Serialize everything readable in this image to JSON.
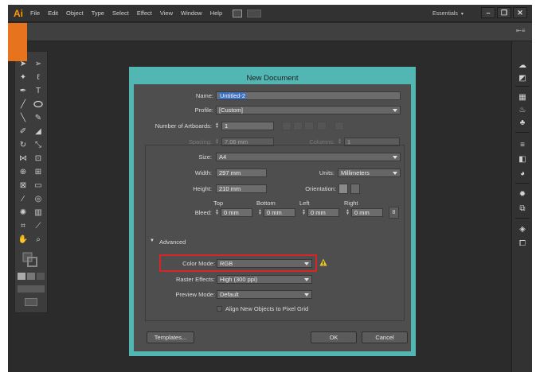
{
  "app": {
    "logo": "Ai",
    "menu": [
      "File",
      "Edit",
      "Object",
      "Type",
      "Select",
      "Effect",
      "View",
      "Window",
      "Help"
    ],
    "workspace": "Essentials",
    "window_controls": [
      "–",
      "❐",
      "✕"
    ]
  },
  "dialog": {
    "title": "New Document",
    "name_label": "Name:",
    "name_value": "Untitled-2",
    "profile_label": "Profile:",
    "profile_value": "[Custom]",
    "artboards_label": "Number of Artboards:",
    "artboards_value": "1",
    "spacing_label": "Spacing:",
    "spacing_value": "7.06 mm",
    "columns_label": "Columns:",
    "columns_value": "1",
    "size_label": "Size:",
    "size_value": "A4",
    "width_label": "Width:",
    "width_value": "297 mm",
    "units_label": "Units:",
    "units_value": "Millimeters",
    "height_label": "Height:",
    "height_value": "210 mm",
    "orientation_label": "Orientation:",
    "bleed_label": "Bleed:",
    "bleed_top_label": "Top",
    "bleed_top_value": "0 mm",
    "bleed_bottom_label": "Bottom",
    "bleed_bottom_value": "0 mm",
    "bleed_left_label": "Left",
    "bleed_left_value": "0 mm",
    "bleed_right_label": "Right",
    "bleed_right_value": "0 mm",
    "advanced_label": "Advanced",
    "color_mode_label": "Color Mode:",
    "color_mode_value": "RGB",
    "raster_label": "Raster Effects:",
    "raster_value": "High (300 ppi)",
    "preview_label": "Preview Mode:",
    "preview_value": "Default",
    "align_label": "Align New Objects to Pixel Grid",
    "templates_button": "Templates...",
    "ok_button": "OK",
    "cancel_button": "Cancel"
  },
  "colors": {
    "dialog_frame": "#52b7b2",
    "highlight": "#d7262a",
    "accent_orange": "#e8731e"
  }
}
